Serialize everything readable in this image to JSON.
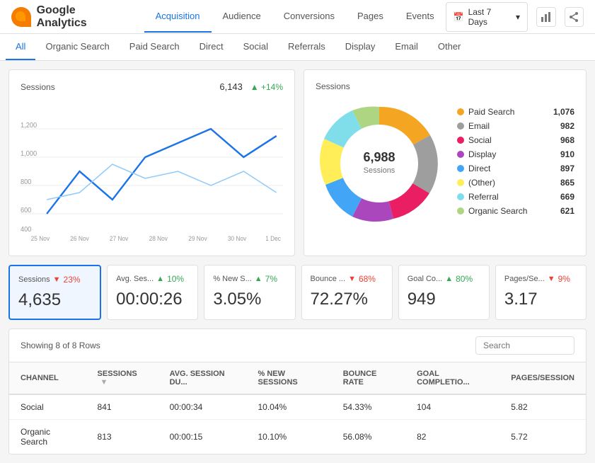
{
  "header": {
    "logo": "Google Analytics",
    "nav": [
      "Acquisition",
      "Audience",
      "Conversions",
      "Pages",
      "Events"
    ],
    "active_nav": "Acquisition",
    "date_range": "Last 7 Days",
    "icons": [
      "bar-chart-icon",
      "share-icon"
    ]
  },
  "sub_nav": {
    "items": [
      "All",
      "Organic Search",
      "Paid Search",
      "Direct",
      "Social",
      "Referrals",
      "Display",
      "Email",
      "Other"
    ],
    "active": "All"
  },
  "line_chart": {
    "title": "Sessions",
    "value": "6,143",
    "change": "+14%",
    "change_type": "positive",
    "x_labels": [
      "25 Nov",
      "26 Nov",
      "27 Nov",
      "28 Nov",
      "29 Nov",
      "30 Nov",
      "1 Dec"
    ]
  },
  "donut_chart": {
    "title": "Sessions",
    "center_value": "6,988",
    "center_label": "Sessions",
    "legend": [
      {
        "label": "Paid Search",
        "value": "1,076",
        "color": "#f4a623"
      },
      {
        "label": "Email",
        "value": "982",
        "color": "#9e9e9e"
      },
      {
        "label": "Social",
        "value": "968",
        "color": "#e91e63"
      },
      {
        "label": "Display",
        "value": "910",
        "color": "#ab47bc"
      },
      {
        "label": "Direct",
        "value": "897",
        "color": "#42a5f5"
      },
      {
        "label": "(Other)",
        "value": "865",
        "color": "#ffee58"
      },
      {
        "label": "Referral",
        "value": "669",
        "color": "#80deea"
      },
      {
        "label": "Organic Search",
        "value": "621",
        "color": "#aed581"
      }
    ]
  },
  "metrics": [
    {
      "label": "Sessions",
      "value": "4,635",
      "change": "23%",
      "change_type": "negative",
      "active": true
    },
    {
      "label": "Avg. Ses...",
      "value": "00:00:26",
      "change": "10%",
      "change_type": "positive",
      "active": false
    },
    {
      "label": "% New S...",
      "value": "3.05%",
      "change": "7%",
      "change_type": "positive",
      "active": false
    },
    {
      "label": "Bounce ...",
      "value": "72.27%",
      "change": "68%",
      "change_type": "negative",
      "active": false
    },
    {
      "label": "Goal Co...",
      "value": "949",
      "change": "80%",
      "change_type": "positive",
      "active": false
    },
    {
      "label": "Pages/Se...",
      "value": "3.17",
      "change": "9%",
      "change_type": "negative",
      "active": false
    }
  ],
  "table": {
    "row_info": "Showing 8 of 8 Rows",
    "search_placeholder": "Search",
    "columns": [
      "CHANNEL",
      "SESSIONS",
      "AVG. SESSION DU...",
      "% NEW SESSIONS",
      "BOUNCE RATE",
      "GOAL COMPLETIO...",
      "PAGES/SESSION"
    ],
    "rows": [
      {
        "channel": "Social",
        "sessions": "841",
        "avg_session": "00:00:34",
        "pct_new": "10.04%",
        "bounce": "54.33%",
        "goal": "104",
        "pages": "5.82"
      },
      {
        "channel": "Organic Search",
        "sessions": "813",
        "avg_session": "00:00:15",
        "pct_new": "10.10%",
        "bounce": "56.08%",
        "goal": "82",
        "pages": "5.72"
      }
    ]
  }
}
